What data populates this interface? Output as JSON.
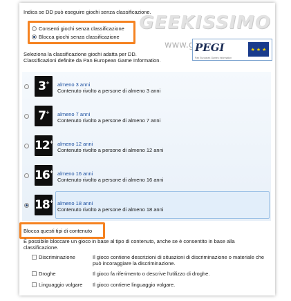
{
  "watermark": {
    "brand": "GEEKISSIMO",
    "url": "www.geekissimo"
  },
  "pegi": {
    "logo": "PEGI",
    "subtitle": "Pan European Games Information"
  },
  "unrated_question": "Indica se DD può eseguire giochi senza classificazione.",
  "unrated_options": [
    {
      "label": "Consenti giochi senza classificazione",
      "checked": false
    },
    {
      "label": "Blocca giochi senza classificazione",
      "checked": true
    }
  ],
  "ratings_intro": {
    "line1": "Seleziona la classificazione giochi adatta per DD.",
    "line2": "Classificazioni definite da Pan European Game Information."
  },
  "ratings": [
    {
      "badge": "3",
      "title": "almeno 3 anni",
      "desc": "Contenuto rivolto a persone di almeno 3 anni",
      "selected": false
    },
    {
      "badge": "7",
      "title": "almeno 7 anni",
      "desc": "Contenuto rivolto a persone di almeno 7 anni",
      "selected": false
    },
    {
      "badge": "12",
      "title": "almeno 12 anni",
      "desc": "Contenuto rivolto a persone di almeno 12 anni",
      "selected": false
    },
    {
      "badge": "16",
      "title": "almeno 16 anni",
      "desc": "Contenuto rivolto a persone di almeno 16 anni",
      "selected": false
    },
    {
      "badge": "18",
      "title": "almeno 18 anni",
      "desc": "Contenuto rivolto a persone di almeno 18 anni",
      "selected": true
    }
  ],
  "content_types": {
    "title": "Blocca questi tipi di contenuto",
    "desc": "È possibile bloccare un gioco in base al tipo di contenuto, anche se è consentito in base alla classificazione.",
    "items": [
      {
        "label": "Discriminazione",
        "desc": "Il gioco contiene descrizioni di situazioni di discriminazione o materiale che può incoraggiare la discriminazione."
      },
      {
        "label": "Droghe",
        "desc": "Il gioco fa riferimento o descrive l'utilizzo di droghe."
      },
      {
        "label": "Linguaggio volgare",
        "desc": "Il gioco contiene linguaggio volgare."
      }
    ]
  },
  "colors": {
    "accent": "#f58220",
    "link": "#1d50a0",
    "selection": "#e2eefa"
  }
}
